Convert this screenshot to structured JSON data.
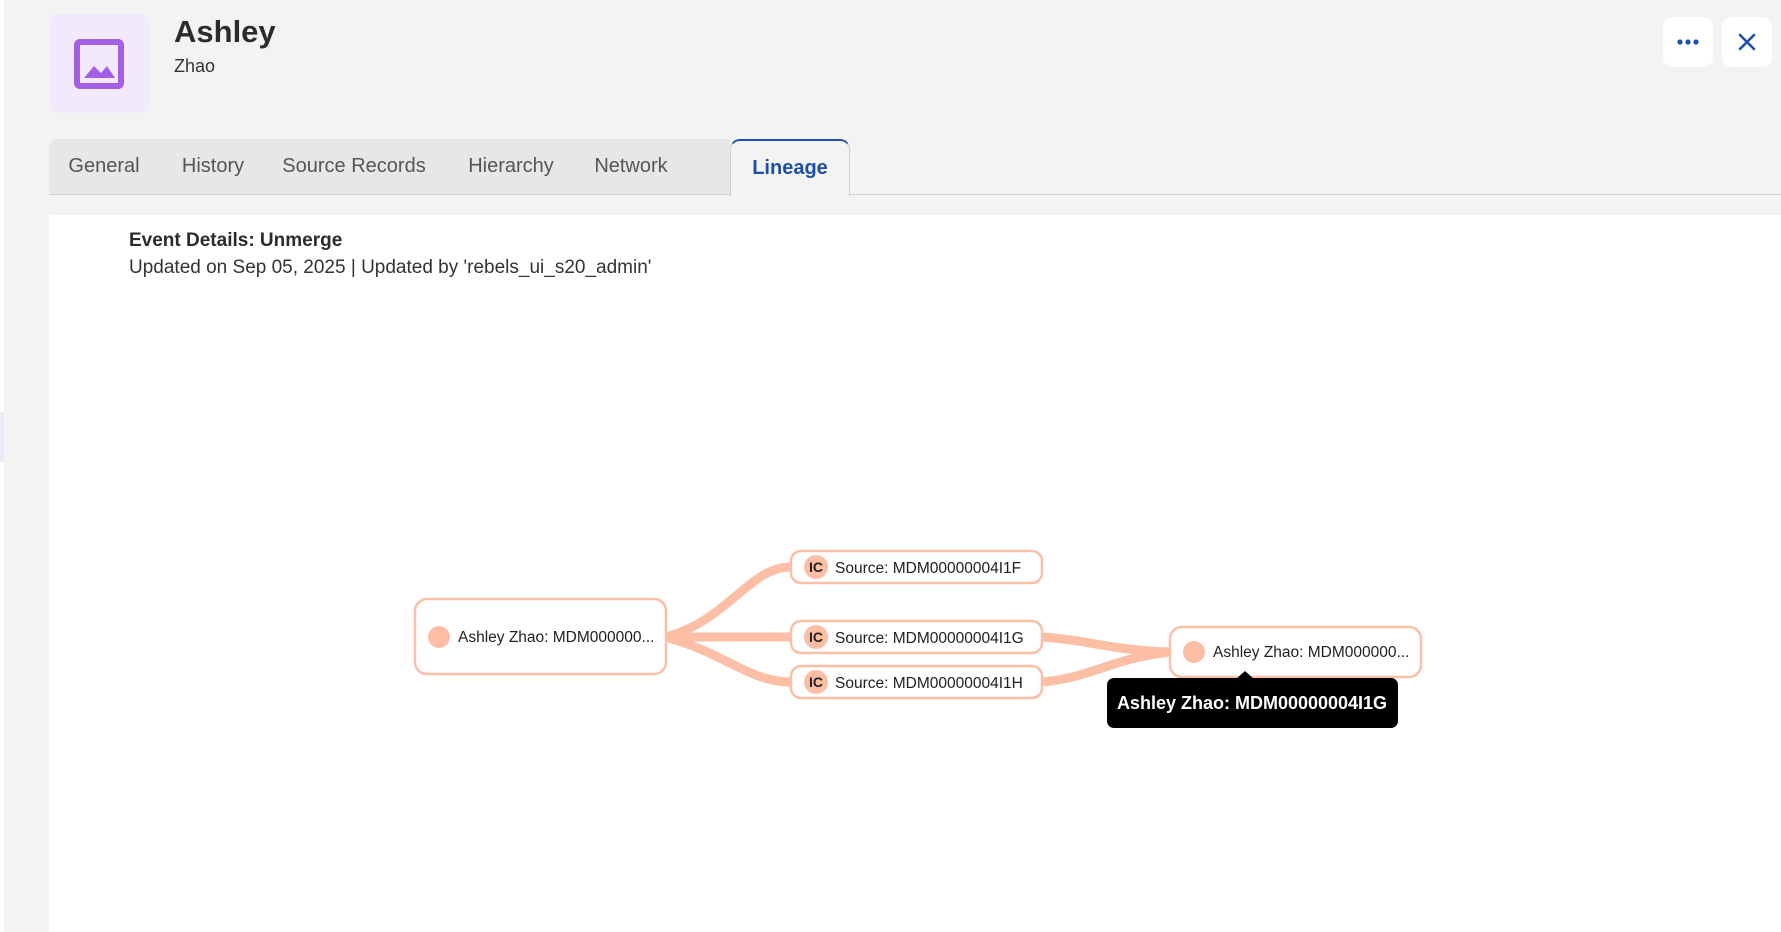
{
  "header": {
    "title": "Ashley",
    "subtitle": "Zhao",
    "avatar_icon": "image-icon",
    "more_icon": "more-horizontal-icon",
    "close_icon": "close-icon"
  },
  "tabs": [
    {
      "label": "General",
      "active": false
    },
    {
      "label": "History",
      "active": false
    },
    {
      "label": "Source Records",
      "active": false
    },
    {
      "label": "Hierarchy",
      "active": false
    },
    {
      "label": "Network",
      "active": false
    },
    {
      "label": "Lineage",
      "active": true
    }
  ],
  "event": {
    "title": "Event Details: Unmerge",
    "meta": "Updated on Sep 05, 2025 | Updated by 'rebels_ui_s20_admin'"
  },
  "lineage": {
    "left_node": {
      "label": "Ashley Zhao: MDM000000..."
    },
    "sources": [
      {
        "badge": "IC",
        "label": "Source: MDM00000004I1F"
      },
      {
        "badge": "IC",
        "label": "Source: MDM00000004I1G"
      },
      {
        "badge": "IC",
        "label": "Source: MDM00000004I1H"
      }
    ],
    "right_node": {
      "label": "Ashley Zhao: MDM000000..."
    },
    "tooltip": "Ashley Zhao: MDM00000004I1G"
  },
  "colors": {
    "accent": "#1c4fa8",
    "link": "#fcbfa6",
    "node_border": "#fbbfa7",
    "node_dot": "#fcbfa6",
    "avatar_bg": "#f2e9fd",
    "avatar_icon": "#a35ee8",
    "tooltip_bg": "#000000"
  }
}
